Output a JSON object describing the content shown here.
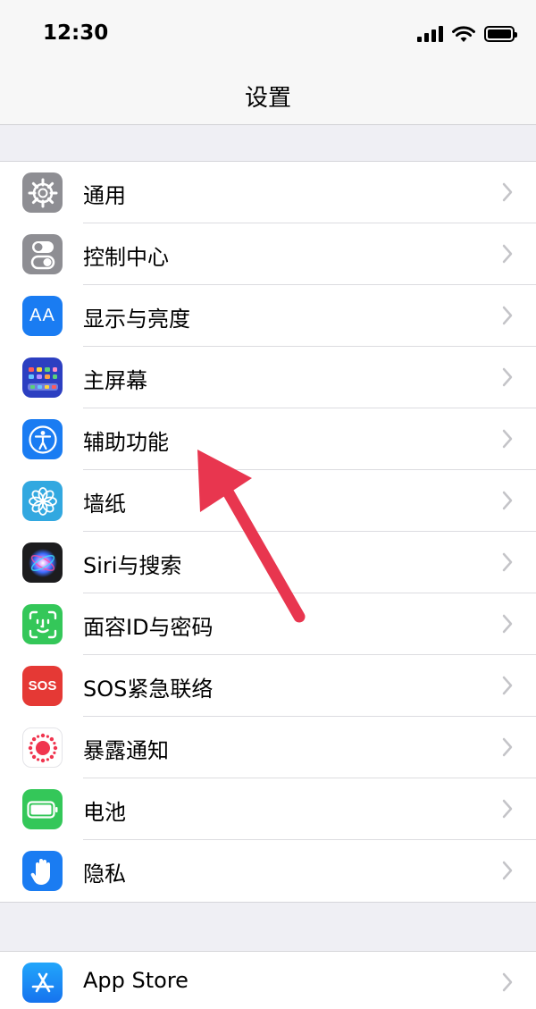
{
  "status_bar": {
    "time": "12:30",
    "signal_icon": "signal-bars-icon",
    "wifi_icon": "wifi-icon",
    "battery_icon": "battery-full-icon"
  },
  "nav": {
    "title": "设置"
  },
  "groups": [
    {
      "items": [
        {
          "id": "general",
          "label": "通用",
          "icon": "gear-icon",
          "color": "#8e8e93"
        },
        {
          "id": "control-center",
          "label": "控制中心",
          "icon": "toggle-switches-icon",
          "color": "#8e8e93"
        },
        {
          "id": "display",
          "label": "显示与亮度",
          "icon": "text-size-icon",
          "color": "#1a7cf2",
          "icon_text": "AA"
        },
        {
          "id": "home-screen",
          "label": "主屏幕",
          "icon": "app-grid-icon",
          "color": "#2c3fc1"
        },
        {
          "id": "accessibility",
          "label": "辅助功能",
          "icon": "accessibility-person-icon",
          "color": "#1a7cf2"
        },
        {
          "id": "wallpaper",
          "label": "墙纸",
          "icon": "flower-icon",
          "color": "#32a8e0"
        },
        {
          "id": "siri",
          "label": "Siri与搜索",
          "icon": "siri-orb-icon",
          "color": "#1c1c1e"
        },
        {
          "id": "face-id",
          "label": "面容ID与密码",
          "icon": "face-id-icon",
          "color": "#34c759"
        },
        {
          "id": "sos",
          "label": "SOS紧急联络",
          "icon": "sos-icon",
          "color": "#e53935",
          "icon_text": "SOS"
        },
        {
          "id": "exposure",
          "label": "暴露通知",
          "icon": "exposure-dots-icon",
          "color": "#ffffff"
        },
        {
          "id": "battery",
          "label": "电池",
          "icon": "battery-icon",
          "color": "#34c759"
        },
        {
          "id": "privacy",
          "label": "隐私",
          "icon": "hand-icon",
          "color": "#1a7cf2"
        }
      ]
    },
    {
      "items": [
        {
          "id": "app-store",
          "label": "App Store",
          "icon": "app-store-icon",
          "color": "#1a8cf5"
        }
      ]
    }
  ],
  "colors": {
    "annotation_arrow": "#e8364f",
    "chevron": "#c4c4c8"
  }
}
